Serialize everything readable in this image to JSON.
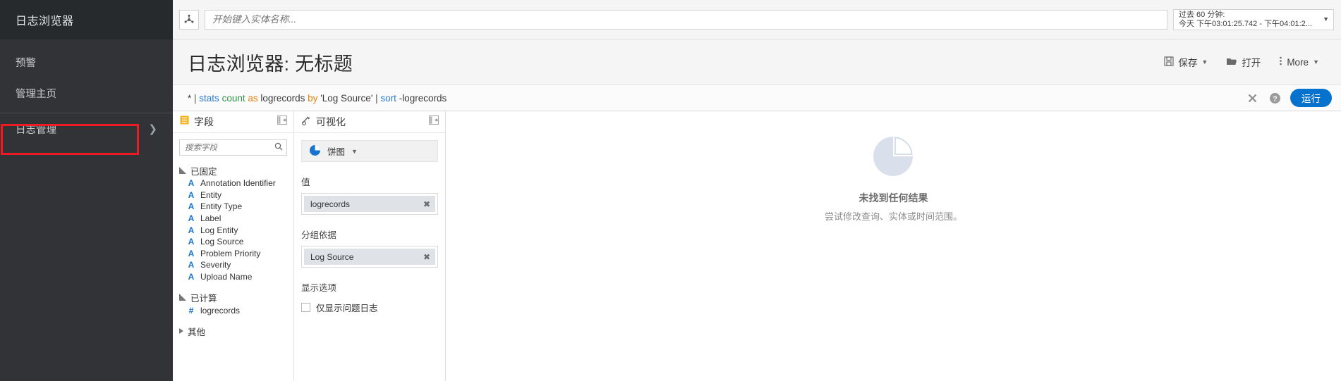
{
  "sidebar": {
    "brand": "日志浏览器",
    "items": [
      {
        "label": "预警",
        "icon": "alert-icon",
        "has_chevron": false,
        "highlighted": false
      },
      {
        "label": "管理主页",
        "icon": "home-icon",
        "has_chevron": false,
        "highlighted": false
      },
      {
        "label": "日志管理",
        "icon": "logs-icon",
        "has_chevron": true,
        "highlighted": true
      }
    ],
    "bg_color": "#313336",
    "highlight_border_color": "#ee1c22"
  },
  "toolbar": {
    "entity_picker_icon": "entity-graph-icon",
    "search_placeholder": "开始键入实体名称...",
    "search_value": "",
    "time_range": {
      "line1": "过去 60 分钟:",
      "line2": "今天 下午03:01:25.742 - 下午04:01:2...",
      "caret": "▼"
    }
  },
  "header": {
    "title": "日志浏览器: 无标题",
    "actions": [
      {
        "label": "保存",
        "icon": "save-icon",
        "caret": "▼"
      },
      {
        "label": "打开",
        "icon": "folder-open-icon",
        "caret": ""
      },
      {
        "label": "More",
        "icon": "kebab-menu-icon",
        "caret": "▼"
      }
    ]
  },
  "query": {
    "tokens": [
      {
        "text": "*",
        "type": "plain"
      },
      {
        "text": " | ",
        "type": "pipe"
      },
      {
        "text": "stats",
        "type": "kw"
      },
      {
        "text": " ",
        "type": "plain"
      },
      {
        "text": "count",
        "type": "fn"
      },
      {
        "text": " ",
        "type": "plain"
      },
      {
        "text": "as",
        "type": "op"
      },
      {
        "text": " logrecords ",
        "type": "plain"
      },
      {
        "text": "by",
        "type": "op"
      },
      {
        "text": " 'Log Source'",
        "type": "str"
      },
      {
        "text": " | ",
        "type": "pipe"
      },
      {
        "text": "sort",
        "type": "kw"
      },
      {
        "text": " -logrecords",
        "type": "plain"
      }
    ],
    "full_text": "* | stats count as logrecords by 'Log Source' | sort -logrecords",
    "clear_icon": "close-icon",
    "help_icon": "help-icon",
    "run_label": "运行",
    "run_color": "#0572ce"
  },
  "fields_panel": {
    "title": "字段",
    "icon": "fields-icon",
    "collapse_icon": "collapse-panel-icon",
    "search_placeholder": "搜索字段",
    "search_value": "",
    "groups": [
      {
        "label": "已固定",
        "expanded": true,
        "items": [
          {
            "name": "Annotation Identifier",
            "type_icon": "A"
          },
          {
            "name": "Entity",
            "type_icon": "A"
          },
          {
            "name": "Entity Type",
            "type_icon": "A"
          },
          {
            "name": "Label",
            "type_icon": "A"
          },
          {
            "name": "Log Entity",
            "type_icon": "A"
          },
          {
            "name": "Log Source",
            "type_icon": "A"
          },
          {
            "name": "Problem Priority",
            "type_icon": "A"
          },
          {
            "name": "Severity",
            "type_icon": "A"
          },
          {
            "name": "Upload Name",
            "type_icon": "A"
          }
        ]
      },
      {
        "label": "已计算",
        "expanded": true,
        "items": [
          {
            "name": "logrecords",
            "type_icon": "#"
          }
        ]
      },
      {
        "label": "其他",
        "expanded": false,
        "items": []
      }
    ]
  },
  "viz_panel": {
    "title": "可视化",
    "icon": "visualization-icon",
    "collapse_icon": "collapse-panel-icon",
    "chart_type": {
      "label": "饼图",
      "icon": "pie-chart-icon",
      "caret": "▼"
    },
    "value_label": "值",
    "value_chip": "logrecords",
    "group_label": "分组依据",
    "group_chip": "Log Source",
    "options_label": "显示选项",
    "option_checkbox": {
      "label": "仅显示问题日志",
      "checked": false
    }
  },
  "results": {
    "empty_icon": "pie-chart-empty-icon",
    "empty_title": "未找到任何结果",
    "empty_subtitle": "尝试修改查询、实体或时间范围。"
  }
}
